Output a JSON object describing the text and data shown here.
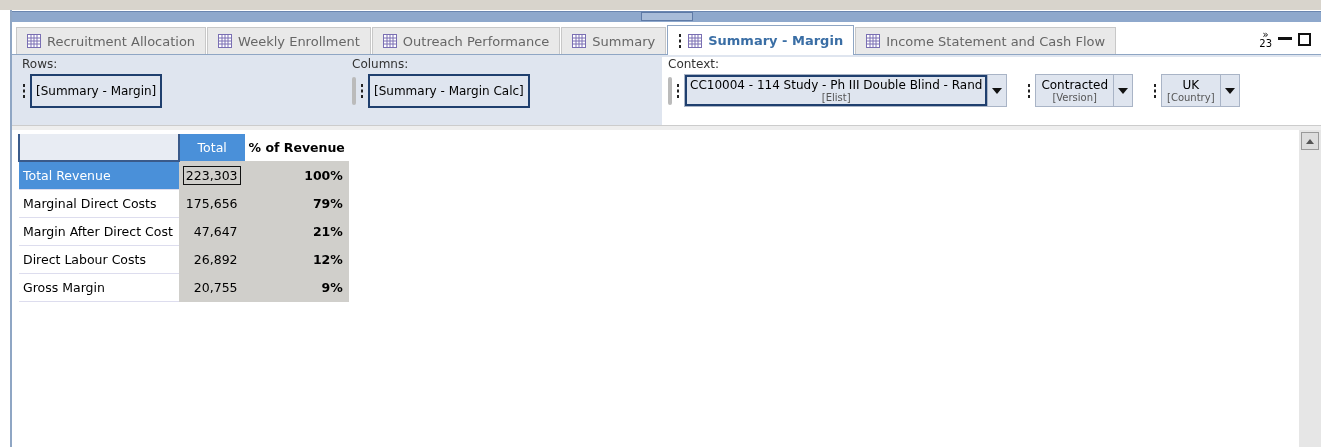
{
  "tabs": [
    {
      "label": "Recruitment Allocation",
      "selected": false
    },
    {
      "label": "Weekly Enrollment",
      "selected": false
    },
    {
      "label": "Outreach Performance",
      "selected": false
    },
    {
      "label": "Summary",
      "selected": false
    },
    {
      "label": "Summary - Margin",
      "selected": true
    },
    {
      "label": "Income Statement and Cash Flow",
      "selected": false
    }
  ],
  "tab_overflow_mark": "»",
  "tab_overflow_count": "23",
  "pov": {
    "rows_label": "Rows:",
    "rows_member": "[Summary - Margin]",
    "columns_label": "Columns:",
    "columns_member": "[Summary - Margin Calc]",
    "context_label": "Context:",
    "context": [
      {
        "value": "CC10004 - 114 Study - Ph III Double Blind - Rand",
        "dimension": "[Elist]",
        "focused": true
      },
      {
        "value": "Contracted",
        "dimension": "[Version]",
        "focused": false
      },
      {
        "value": "UK",
        "dimension": "[Country]",
        "focused": false
      }
    ]
  },
  "grid": {
    "columns": [
      {
        "label": "Total",
        "selected": true
      },
      {
        "label": "% of Revenue",
        "selected": false
      }
    ],
    "rows": [
      {
        "label": "Total Revenue",
        "selected": true,
        "focused": true,
        "total": "223,303",
        "percent": "100%"
      },
      {
        "label": "Marginal Direct Costs",
        "selected": false,
        "focused": false,
        "total": "175,656",
        "percent": "79%"
      },
      {
        "label": "Margin After Direct Cost",
        "selected": false,
        "focused": false,
        "total": "47,647",
        "percent": "21%"
      },
      {
        "label": "Direct Labour Costs",
        "selected": false,
        "focused": false,
        "total": "26,892",
        "percent": "12%"
      },
      {
        "label": "Gross Margin",
        "selected": false,
        "focused": false,
        "total": "20,755",
        "percent": "9%"
      }
    ]
  }
}
